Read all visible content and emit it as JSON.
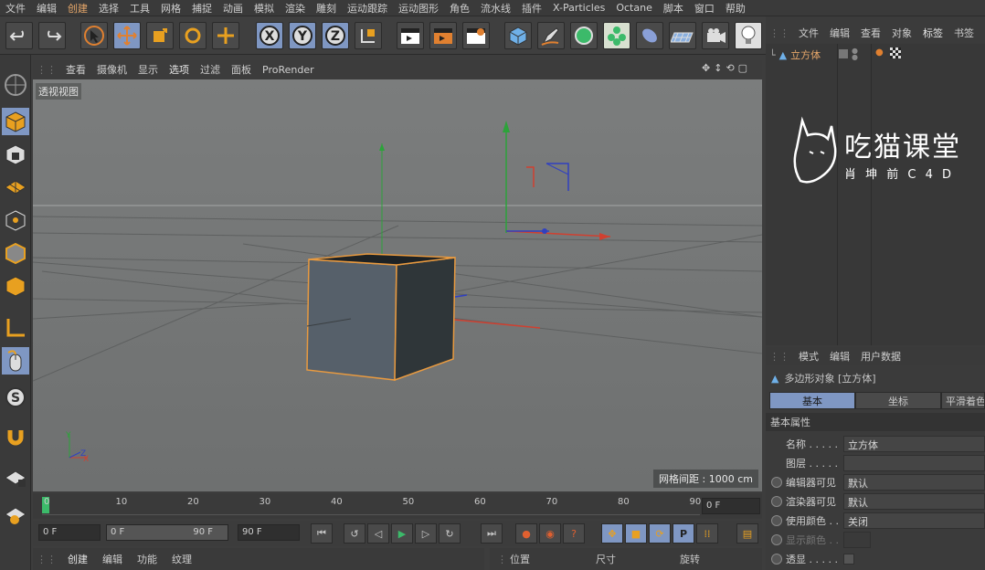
{
  "menu": [
    "文件",
    "编辑",
    "创建",
    "选择",
    "工具",
    "网格",
    "捕捉",
    "动画",
    "模拟",
    "渲染",
    "雕刻",
    "运动跟踪",
    "运动图形",
    "角色",
    "流水线",
    "插件",
    "X-Particles",
    "Octane",
    "脚本",
    "窗口",
    "帮助"
  ],
  "viewport_menu": [
    "查看",
    "摄像机",
    "显示",
    "选项",
    "过滤",
    "面板",
    "ProRender"
  ],
  "viewport_label": "透视视图",
  "grid_spacing": "网格间距 : 1000 cm",
  "timeline_ticks": [
    "0",
    "10",
    "20",
    "30",
    "40",
    "50",
    "60",
    "70",
    "80",
    "90"
  ],
  "frame_field": "0 F",
  "play": {
    "start": "0 F",
    "range_start": "0 F",
    "range_end": "90 F",
    "end": "90 F"
  },
  "bottom_tabs": [
    "创建",
    "编辑",
    "功能",
    "纹理"
  ],
  "coord_headers": [
    "位置",
    "尺寸",
    "旋转"
  ],
  "object_menu": [
    "文件",
    "编辑",
    "查看",
    "对象",
    "标签",
    "书签"
  ],
  "object_name": "立方体",
  "watermark": {
    "title": "吃猫课堂",
    "subtitle": "肖 坤 前 C 4 D"
  },
  "attr_menu": [
    "模式",
    "编辑",
    "用户数据"
  ],
  "attr_title": "多边形对象 [立方体]",
  "attr_tabs": [
    "基本",
    "坐标",
    "平滑着色"
  ],
  "section": "基本属性",
  "props": [
    {
      "label": "名称 . . . . .",
      "value": "立方体"
    },
    {
      "label": "图层 . . . . .",
      "value": ""
    },
    {
      "label": "编辑器可见",
      "value": "默认"
    },
    {
      "label": "渲染器可见",
      "value": "默认"
    },
    {
      "label": "使用颜色 . .",
      "value": "关闭"
    },
    {
      "label": "显示颜色 . .",
      "value": ""
    },
    {
      "label": "透显 . . . . .",
      "value": ""
    }
  ],
  "axis_letters": {
    "x": "X",
    "y": "Y",
    "z": "Z",
    "p": "P"
  },
  "colors": {
    "accent": "#e8a86a",
    "highlight": "#7f97c3",
    "cube": "#56606a"
  }
}
